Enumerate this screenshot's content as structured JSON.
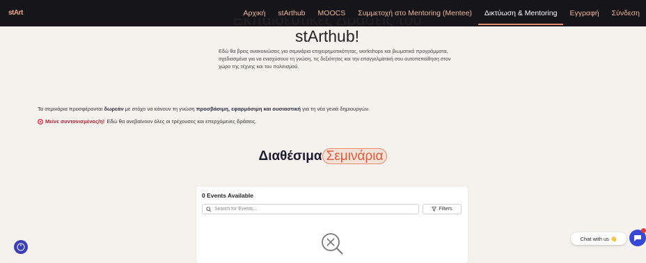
{
  "header": {
    "logo_main": "st",
    "logo_accent": "Art",
    "nav": [
      {
        "label": "Αρχική"
      },
      {
        "label": "stArthub"
      },
      {
        "label": "MOOCS"
      },
      {
        "label": "Συμμετοχή στο Mentoring (Mentee)"
      },
      {
        "label": "Δικτύωση & Mentoring"
      },
      {
        "label": "Εγγραφή"
      },
      {
        "label": "Σύνδεση"
      }
    ],
    "active_index": 4
  },
  "hero": {
    "title_line1": "Εκπαιδευτικές Δράσεις του",
    "title_line2": "stArthub!",
    "intro": "Εδώ θα βρεις ανακοινώσεις για σεμινάρια επιχειρηματικότητας, workshops και βιωματικά προγράμματα, σχεδιασμένα για να ενισχύσουν τη γνώση, τις δεξιότητες και την επαγγελματική σου αυτοπεποίθηση στον χώρο της τέχνης και του πολιτισμού."
  },
  "notices": {
    "n1_part1": "Τα σεμινάρια προσφέρονται ",
    "n1_bold1": "δωρεάν",
    "n1_part2": " με στόχο να κάνουν τη γνώση ",
    "n1_bold2": "προσβάσιμη, εφαρμόσιμη και ουσιαστική",
    "n1_part3": " για τη νέα γενιά δημιουργών.",
    "n2_highlight": "Μείνε συντονισμένος/η!",
    "n2_text": " Εδώ θα ανεβαίνουν όλες οι τρέχουσες και επερχόμενες δράσεις."
  },
  "section": {
    "title_main": "Διαθέσιμα",
    "title_accent": "Σεμινάρια"
  },
  "events": {
    "count_label": "0 Events Available",
    "search_placeholder": "Search for Events...",
    "filters_label": "Filters"
  },
  "chat": {
    "label": "Chat with us 👋"
  },
  "colors": {
    "nav_bg": "#16161a",
    "nav_text": "#f0b59c",
    "accent": "#e05a3c",
    "page_bg": "#f5f1ec",
    "chat_button": "#3747d8"
  }
}
